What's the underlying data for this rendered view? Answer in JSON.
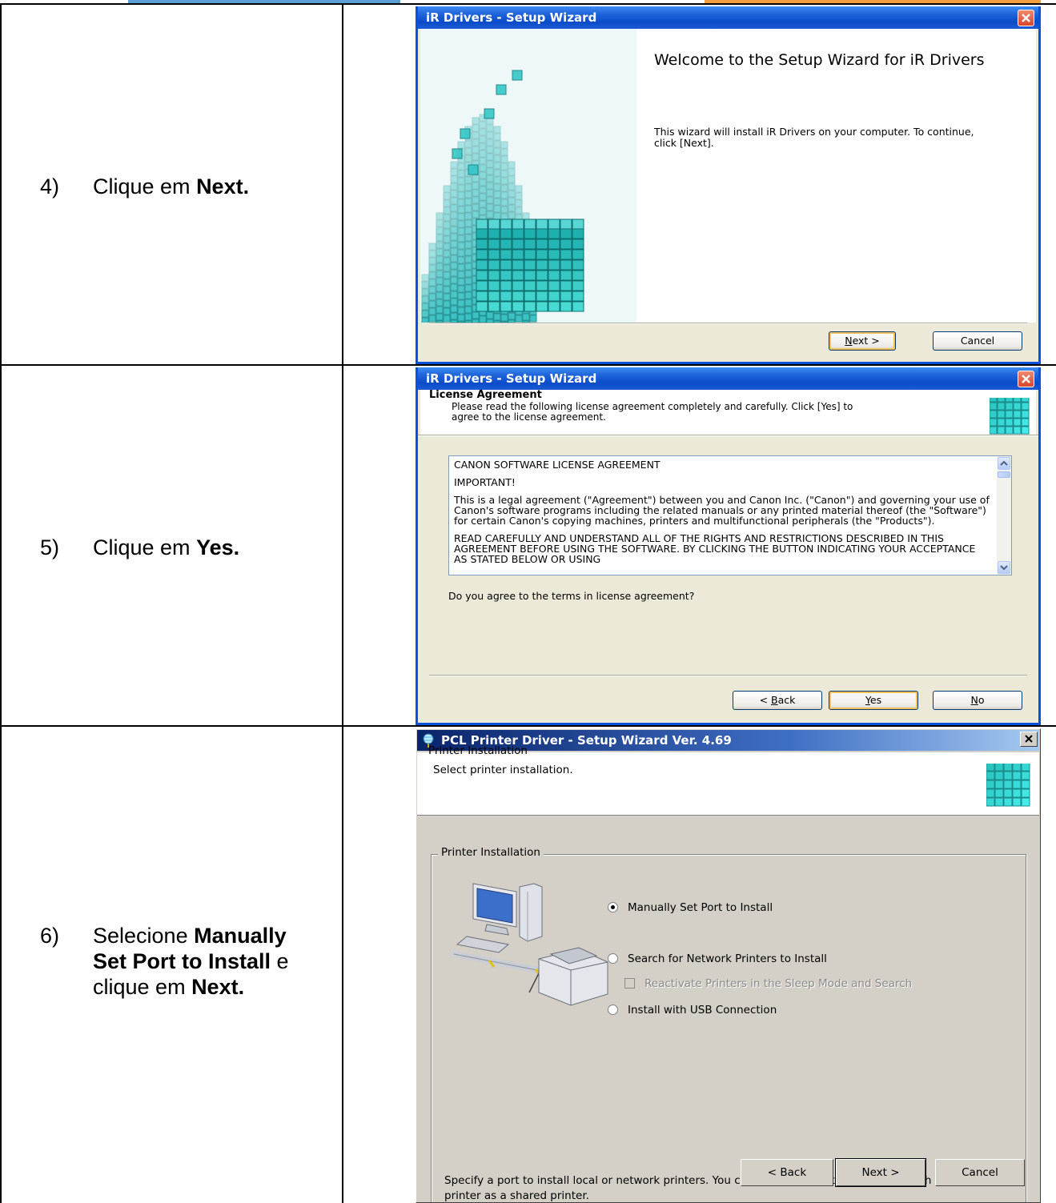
{
  "steps": [
    {
      "num": "4)",
      "text_before": "Clique em ",
      "bold": "Next.",
      "text_after": ""
    },
    {
      "num": "5)",
      "text_before": "Clique em ",
      "bold": "Yes.",
      "text_after": ""
    },
    {
      "num": "6)",
      "text_before": "Selecione ",
      "bold": "Manually Set Port to Install",
      "text_after": " e",
      "line2_before": "clique em ",
      "line2_bold": "Next."
    }
  ],
  "wizard1": {
    "title": "iR Drivers - Setup Wizard",
    "heading": "Welcome to the Setup Wizard for iR Drivers",
    "body": "This wizard will install iR Drivers on your computer. To continue, click [Next].",
    "next_button": "Next >",
    "cancel_button": "Cancel"
  },
  "wizard2": {
    "title": "iR Drivers - Setup Wizard",
    "header_title": "License Agreement",
    "header_desc": "Please read the following license agreement completely and carefully. Click [Yes] to agree to the license agreement.",
    "license_paragraphs": [
      "CANON SOFTWARE LICENSE AGREEMENT",
      "IMPORTANT!",
      "This is a legal agreement (\"Agreement\") between you and Canon Inc. (\"Canon\") and governing your use of Canon's software programs including the related manuals or any printed material thereof (the \"Software\") for certain Canon's copying machines, printers and multifunctional peripherals (the \"Products\").",
      "READ CAREFULLY AND UNDERSTAND ALL OF THE RIGHTS AND RESTRICTIONS DESCRIBED IN THIS AGREEMENT BEFORE USING THE SOFTWARE.  BY CLICKING THE BUTTON INDICATING YOUR ACCEPTANCE AS STATED BELOW OR USING"
    ],
    "question": "Do you agree to the terms in license agreement?",
    "back_button": "< Back",
    "yes_button": "Yes",
    "no_button": "No"
  },
  "wizard3": {
    "title": "PCL Printer Driver - Setup Wizard Ver. 4.69",
    "header_title": "Printer Installation",
    "header_desc": "Select printer installation.",
    "group_label": "Printer Installation",
    "options": [
      {
        "label": "Manually Set Port to Install",
        "selected": true
      },
      {
        "label": "Search for Network Printers to Install",
        "selected": false
      },
      {
        "label": "Install with USB Connection",
        "selected": false
      }
    ],
    "checkbox_label": "Reactivate Printers in the Sleep Mode and Search",
    "checkbox_checked": false,
    "description": "Specify a port to install local or network printers. You can also specify other settings, such as setting a printer as a shared printer.",
    "back_button": "< Back",
    "next_button": "Next >",
    "cancel_button": "Cancel"
  },
  "colors": {
    "xp_title_blue": "#0a52d9",
    "xp_face": "#ece9d8",
    "classic_face": "#d4d0c8",
    "cube_teal": "#2fc3c3"
  }
}
